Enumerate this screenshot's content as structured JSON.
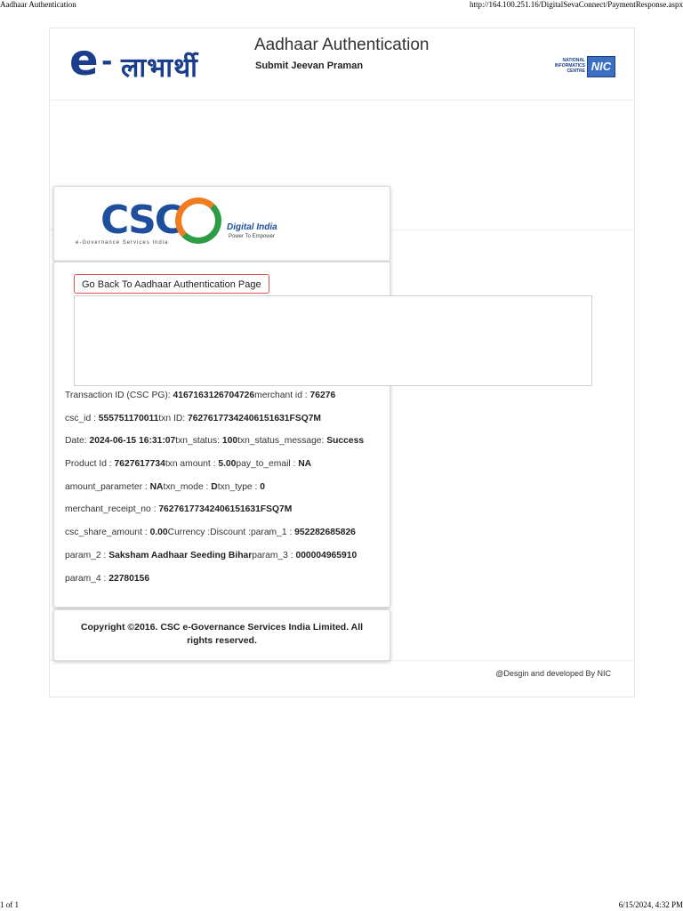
{
  "print": {
    "header_left": "Aadhaar Authentication",
    "header_right": "http://164.100.251.16/DigitalSevaConnect/PaymentResponse.aspx",
    "footer_left": "1 of 1",
    "footer_right": "6/15/2024, 4:32 PM"
  },
  "brand": {
    "e": "e",
    "hyphen": "-",
    "hindi": "लाभार्थी"
  },
  "header": {
    "title": "Aadhaar Authentication",
    "subtitle": "Submit Jeevan Praman"
  },
  "nic": {
    "text": "NATIONAL INFORMATICS CENTRE",
    "box": "NIC"
  },
  "csc": {
    "letters": "CSC",
    "tagline": "e-Governance Services India",
    "di_label": "Digital India",
    "di_sub": "Power To Empower"
  },
  "back_button": "Go Back To Aadhaar Authentication Page",
  "rows": [
    [
      [
        "Transaction ID (CSC PG): ",
        "4167163126704726"
      ],
      [
        "merchant id : ",
        "76276"
      ]
    ],
    [
      [
        "csc_id : ",
        "555751170011"
      ],
      [
        "txn ID: ",
        "76276177342406151631FSQ7M"
      ]
    ],
    [
      [
        "Date: ",
        "2024-06-15 16:31:07"
      ],
      [
        "txn_status: ",
        "100"
      ],
      [
        "txn_status_message: ",
        "Success"
      ]
    ],
    [
      [
        "Product Id : ",
        "7627617734"
      ],
      [
        "txn amount : ",
        "5.00"
      ],
      [
        "pay_to_email : ",
        "NA"
      ]
    ],
    [
      [
        "amount_parameter : ",
        "NA"
      ],
      [
        "txn_mode : ",
        "D"
      ],
      [
        "txn_type : ",
        "0"
      ]
    ],
    [
      [
        "merchant_receipt_no : ",
        "76276177342406151631FSQ7M"
      ]
    ],
    [
      [
        "csc_share_amount : ",
        "0.00"
      ],
      [
        "Currency :",
        ""
      ],
      [
        "Discount :",
        ""
      ],
      [
        "param_1 : ",
        "952282685826"
      ]
    ],
    [
      [
        "param_2 : ",
        "Saksham Aadhaar Seeding Bihar"
      ],
      [
        "param_3 : ",
        "000004965910"
      ]
    ],
    [
      [
        "param_4 : ",
        "22780156"
      ]
    ]
  ],
  "copyright": "Copyright ©2016. CSC e-Governance Services India Limited. All rights reserved.",
  "dev_credit": "@Desgin and developed By NIC"
}
